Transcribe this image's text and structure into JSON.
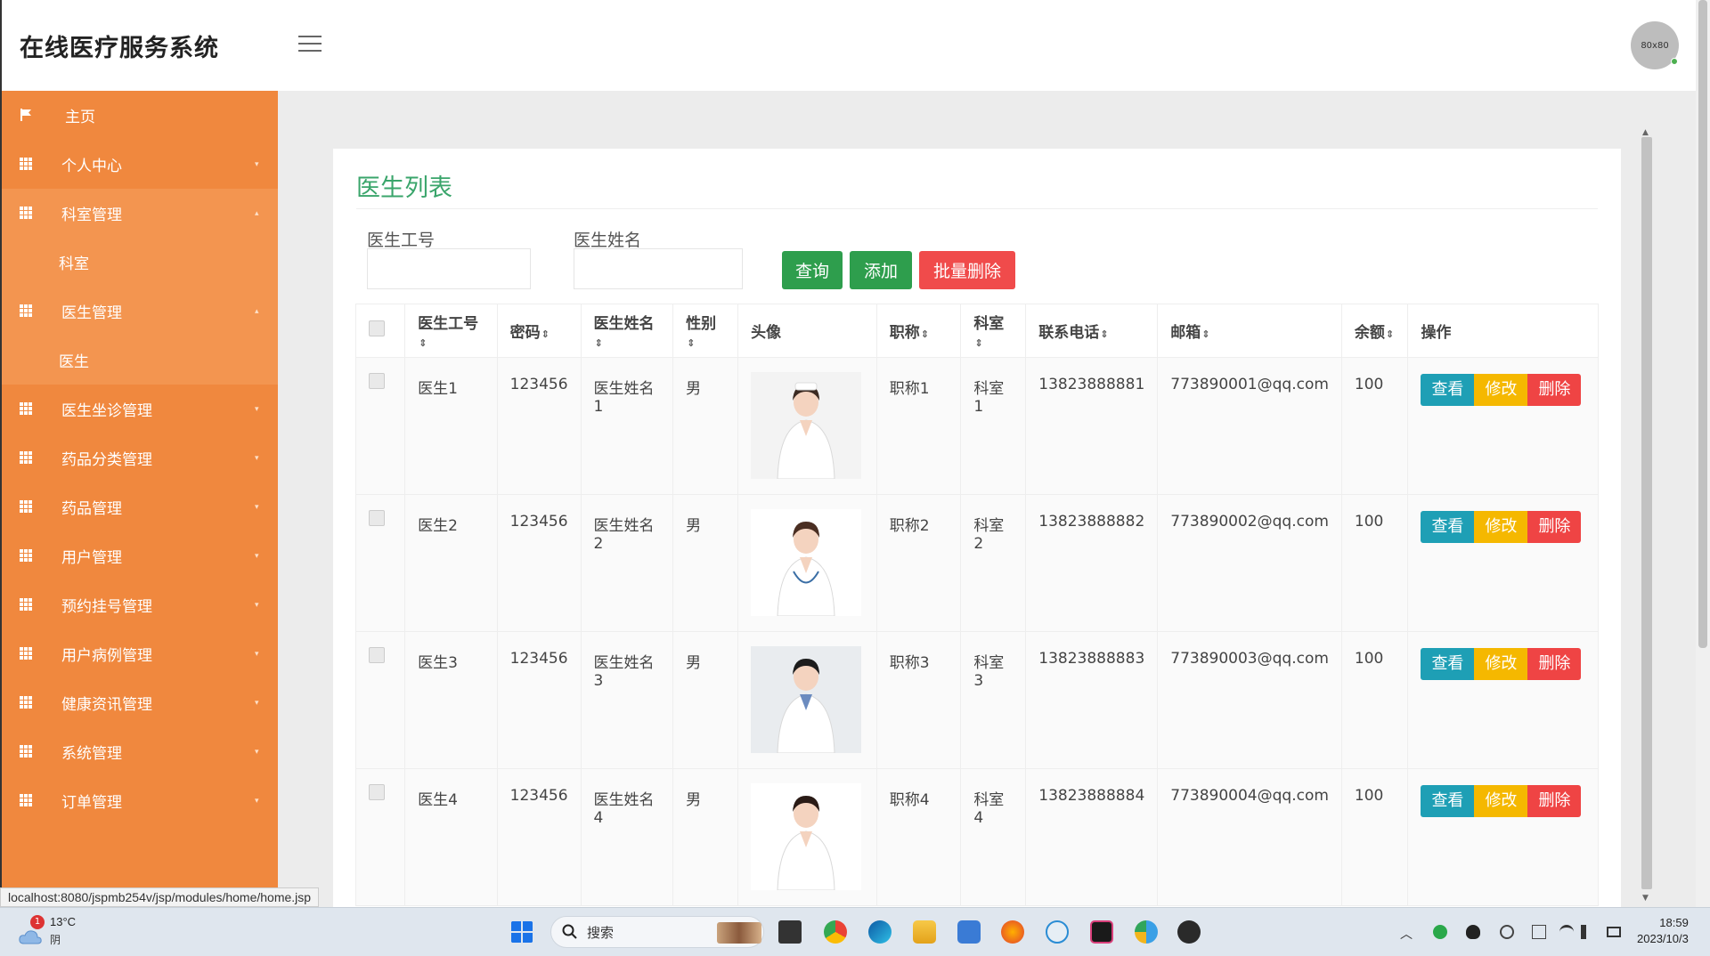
{
  "app": {
    "title": "在线医疗服务系统",
    "avatar_text": "80x80"
  },
  "sidebar": {
    "items": [
      {
        "label": "主页",
        "type": "home"
      },
      {
        "label": "个人中心",
        "caret": "▾"
      },
      {
        "label": "科室管理",
        "caret": "▴",
        "sub": "科室"
      },
      {
        "label": "医生管理",
        "caret": "▴",
        "sub": "医生"
      },
      {
        "label": "医生坐诊管理",
        "caret": "▾"
      },
      {
        "label": "药品分类管理",
        "caret": "▾"
      },
      {
        "label": "药品管理",
        "caret": "▾"
      },
      {
        "label": "用户管理",
        "caret": "▾"
      },
      {
        "label": "预约挂号管理",
        "caret": "▾"
      },
      {
        "label": "用户病例管理",
        "caret": "▾"
      },
      {
        "label": "健康资讯管理",
        "caret": "▾"
      },
      {
        "label": "系统管理",
        "caret": "▾"
      },
      {
        "label": "订单管理",
        "caret": "▾"
      }
    ]
  },
  "page": {
    "title": "医生列表",
    "search": {
      "doctor_no_label": "医生工号",
      "doctor_no_value": "",
      "doctor_name_label": "医生姓名",
      "doctor_name_value": ""
    },
    "buttons": {
      "query": "查询",
      "add": "添加",
      "batch_delete": "批量删除"
    }
  },
  "table": {
    "sort_glyph": "⇕",
    "columns": [
      "医生工号",
      "密码",
      "医生姓名",
      "性别",
      "头像",
      "职称",
      "科室",
      "联系电话",
      "邮箱",
      "余额",
      "操作"
    ],
    "actions": {
      "view": "查看",
      "edit": "修改",
      "delete": "删除"
    },
    "rows": [
      {
        "no": "医生1",
        "password": "123456",
        "name": "医生姓名1",
        "gender": "男",
        "title": "职称1",
        "dept": "科室1",
        "phone": "13823888881",
        "email": "773890001@qq.com",
        "balance": "100"
      },
      {
        "no": "医生2",
        "password": "123456",
        "name": "医生姓名2",
        "gender": "男",
        "title": "职称2",
        "dept": "科室2",
        "phone": "13823888882",
        "email": "773890002@qq.com",
        "balance": "100"
      },
      {
        "no": "医生3",
        "password": "123456",
        "name": "医生姓名3",
        "gender": "男",
        "title": "职称3",
        "dept": "科室3",
        "phone": "13823888883",
        "email": "773890003@qq.com",
        "balance": "100"
      },
      {
        "no": "医生4",
        "password": "123456",
        "name": "医生姓名4",
        "gender": "男",
        "title": "职称4",
        "dept": "科室4",
        "phone": "13823888884",
        "email": "773890004@qq.com",
        "balance": "100"
      }
    ]
  },
  "status_url": "localhost:8080/jspmb254v/jsp/modules/home/home.jsp",
  "taskbar": {
    "weather_temp": "13°C",
    "weather_desc": "阴",
    "weather_badge": "1",
    "search_text": "搜索",
    "time": "18:59",
    "date": "2023/10/3"
  },
  "colors": {
    "sidebar": "#f0883e",
    "accent_green": "#3aa56b",
    "btn_view": "#1e9fb5",
    "btn_edit": "#f5b800",
    "btn_delete": "#ef4444"
  }
}
